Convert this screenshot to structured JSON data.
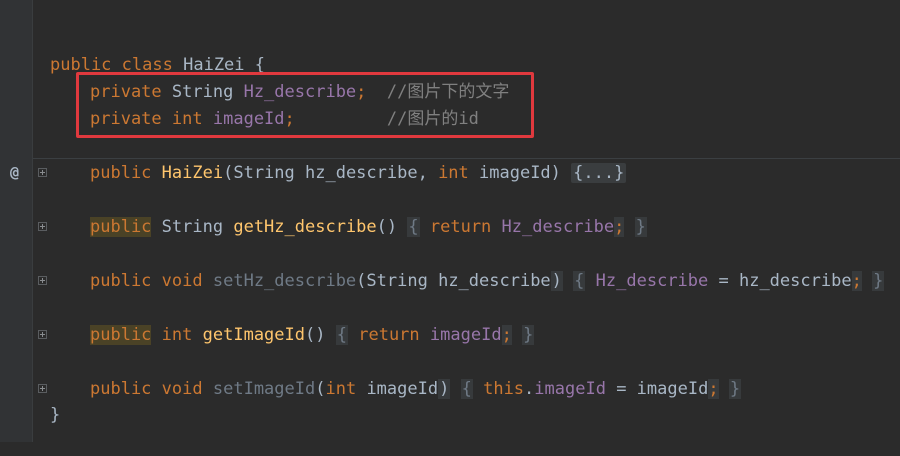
{
  "editor": {
    "colors": {
      "background": "#2b2b2b",
      "keyword": "#cc7832",
      "field": "#9876aa",
      "method_decl": "#ffc66d",
      "comment": "#808080",
      "highlight_box": "#e0393e"
    },
    "class_decl": {
      "kw_public": "public",
      "kw_class": "class",
      "name": "HaiZei",
      "open_brace": "{"
    },
    "field1": {
      "kw": "private",
      "type": "String",
      "name": "Hz_describe",
      "semi": ";",
      "comment": "//图片下的文字"
    },
    "field2": {
      "kw": "private",
      "type": "int",
      "name": "imageId",
      "semi": ";",
      "comment": "//图片的id"
    },
    "ctor": {
      "kw": "public",
      "name": "HaiZei",
      "paren_open": "(",
      "p1_type": "String",
      "p1_name": " hz_describe, ",
      "p2_type": "int",
      "p2_name": " imageId",
      "paren_close": ")",
      "folded": "{...}"
    },
    "m1": {
      "kw": "public",
      "type": "String",
      "name": "getHz_describe",
      "parens": "()",
      "open": "{",
      "ret": "return",
      "field": "Hz_describe",
      "semi": ";",
      "close": "}"
    },
    "m2": {
      "kw": "public",
      "type": "void",
      "name": "setHz_describe",
      "paren_open": "(",
      "p_type": "String",
      "p_name": " hz_describe",
      "paren_close": ")",
      "open": "{",
      "field": "Hz_describe",
      "assign": " = hz_describe",
      "semi": ";",
      "close": "}"
    },
    "m3": {
      "kw": "public",
      "type": "int",
      "name": "getImageId",
      "parens": "()",
      "open": "{",
      "ret": "return",
      "field": "imageId",
      "semi": ";",
      "close": "}"
    },
    "m4": {
      "kw": "public",
      "type": "void",
      "name": "setImageId",
      "paren_open": "(",
      "p_type": "int",
      "p_name": " imageId",
      "paren_close": ")",
      "open": "{",
      "this": "this",
      "dot": ".",
      "field": "imageId",
      "assign": " = imageId",
      "semi": ";",
      "close": "}"
    },
    "class_close": "}",
    "override_marker": "@"
  }
}
